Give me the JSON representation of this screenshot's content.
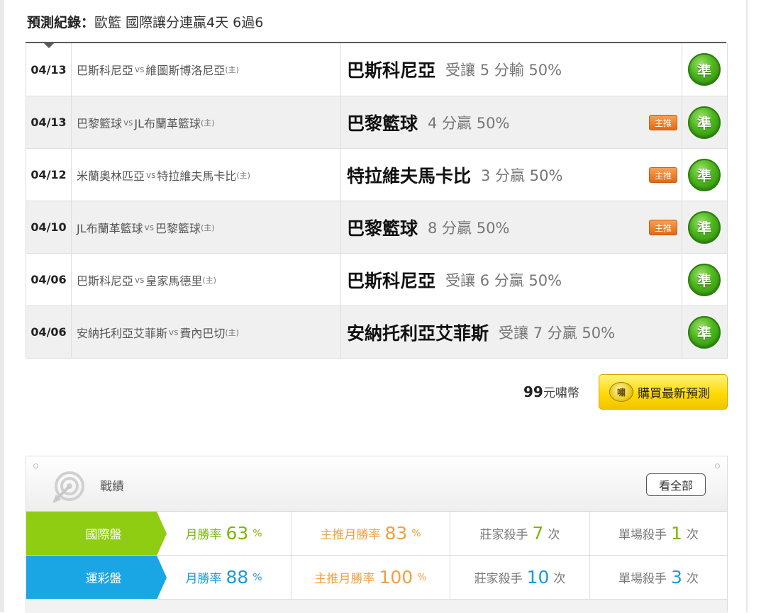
{
  "header": {
    "title": "預測紀錄：",
    "subtitle": "歐籃 國際讓分連贏4天 6過6"
  },
  "records": [
    {
      "date": "04/13",
      "team_a": "巴斯科尼亞",
      "vs": "vs",
      "team_b": "維圖斯博洛尼亞",
      "home_mark": "(主)",
      "pick_team": "巴斯科尼亞",
      "pick_desc": "受讓 5 分輸 50%",
      "main_badge": "",
      "result": "準"
    },
    {
      "date": "04/13",
      "team_a": "巴黎籃球",
      "vs": "vs",
      "team_b": "JL布蘭革籃球",
      "home_mark": "(主)",
      "pick_team": "巴黎籃球",
      "pick_desc": "4 分贏 50%",
      "main_badge": "主推",
      "result": "準"
    },
    {
      "date": "04/12",
      "team_a": "米蘭奧林匹亞",
      "vs": "vs",
      "team_b": "特拉維夫馬卡比",
      "home_mark": "(主)",
      "pick_team": "特拉維夫馬卡比",
      "pick_desc": "3 分贏 50%",
      "main_badge": "主推",
      "result": "準"
    },
    {
      "date": "04/10",
      "team_a": "JL布蘭革籃球",
      "vs": "vs",
      "team_b": "巴黎籃球",
      "home_mark": "(主)",
      "pick_team": "巴黎籃球",
      "pick_desc": "8 分贏 50%",
      "main_badge": "主推",
      "result": "準"
    },
    {
      "date": "04/06",
      "team_a": "巴斯科尼亞",
      "vs": "vs",
      "team_b": "皇家馬德里",
      "home_mark": "(主)",
      "pick_team": "巴斯科尼亞",
      "pick_desc": "受讓 6 分贏 50%",
      "main_badge": "",
      "result": "準"
    },
    {
      "date": "04/06",
      "team_a": "安納托利亞艾菲斯",
      "vs": "vs",
      "team_b": "費內巴切",
      "home_mark": "(主)",
      "pick_team": "安納托利亞艾菲斯",
      "pick_desc": "受讓 7 分贏 50%",
      "main_badge": "",
      "result": "準"
    }
  ],
  "purchase": {
    "price": "99",
    "unit": "元嘯幣",
    "coin_glyph": "嘯",
    "button_label": "購買最新預測"
  },
  "stats": {
    "title": "戰績",
    "view_all": "看全部",
    "rows": [
      {
        "label": "國際盤",
        "monthly_label": "月勝率",
        "monthly_value": "63",
        "monthly_unit": "%",
        "main_label": "主推月勝率",
        "main_value": "83",
        "main_unit": "%",
        "killer_label": "莊家殺手",
        "killer_value": "7",
        "killer_unit": "次",
        "single_label": "單場殺手",
        "single_value": "1",
        "single_unit": "次"
      },
      {
        "label": "運彩盤",
        "monthly_label": "月勝率",
        "monthly_value": "88",
        "monthly_unit": "%",
        "main_label": "主推月勝率",
        "main_value": "100",
        "main_unit": "%",
        "killer_label": "莊家殺手",
        "killer_value": "10",
        "killer_unit": "次",
        "single_label": "單場殺手",
        "single_value": "3",
        "single_unit": "次"
      }
    ]
  },
  "colors": {
    "intl_green": "#8fcd12",
    "lottery_blue": "#1aa6e4",
    "accent_orange": "#f0a040",
    "hit_green": "#4bb51c",
    "buy_yellow": "#ffd800"
  }
}
